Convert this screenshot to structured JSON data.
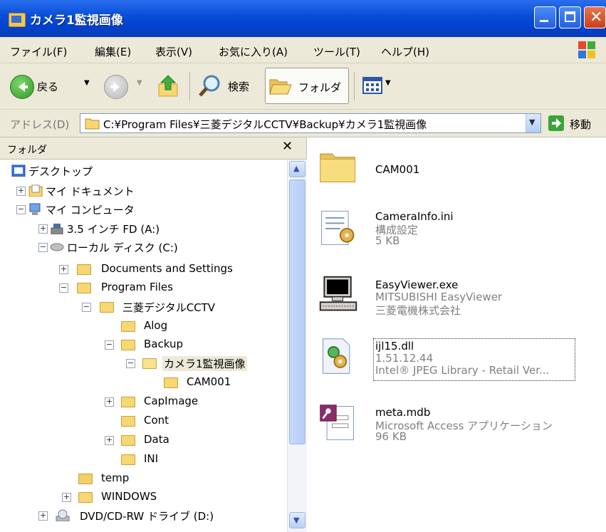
{
  "window": {
    "title": "カメラ1監視画像"
  },
  "menu": [
    "ファイル(F)",
    "編集(E)",
    "表示(V)",
    "お気に入り(A)",
    "ツール(T)",
    "ヘルプ(H)"
  ],
  "toolbar": {
    "back": "戻る",
    "search": "検索",
    "folders": "フォルダ"
  },
  "address": {
    "label": "アドレス(D)",
    "path": "C:¥Program Files¥三菱デジタルCCTV¥Backup¥カメラ1監視画像",
    "go": "移動"
  },
  "tree": {
    "title": "フォルダ",
    "items": [
      {
        "label": "デスクトップ"
      },
      {
        "label": "マイ ドキュメント"
      },
      {
        "label": "マイ コンピュータ"
      },
      {
        "label": "3.5 インチ FD (A:)"
      },
      {
        "label": "ローカル ディスク (C:)"
      },
      {
        "label": "Documents and Settings"
      },
      {
        "label": "Program Files"
      },
      {
        "label": "三菱デジタルCCTV"
      },
      {
        "label": "Alog"
      },
      {
        "label": "Backup"
      },
      {
        "label": "カメラ1監視画像"
      },
      {
        "label": "CAM001"
      },
      {
        "label": "CapImage"
      },
      {
        "label": "Cont"
      },
      {
        "label": "Data"
      },
      {
        "label": "INI"
      },
      {
        "label": "temp"
      },
      {
        "label": "WINDOWS"
      },
      {
        "label": "DVD/CD-RW ドライブ (D:)"
      }
    ]
  },
  "files": [
    {
      "name": "CAM001",
      "line2": "",
      "line3": ""
    },
    {
      "name": "CameraInfo.ini",
      "line2": "構成設定",
      "line3": "5 KB"
    },
    {
      "name": "EasyViewer.exe",
      "line2": "MITSUBISHI EasyViewer",
      "line3": "三菱電機株式会社"
    },
    {
      "name": "ijl15.dll",
      "line2": "1.51.12.44",
      "line3": "Intel® JPEG Library - Retail Ver..."
    },
    {
      "name": "meta.mdb",
      "line2": "Microsoft Access アプリケーション",
      "line3": "96 KB"
    }
  ]
}
